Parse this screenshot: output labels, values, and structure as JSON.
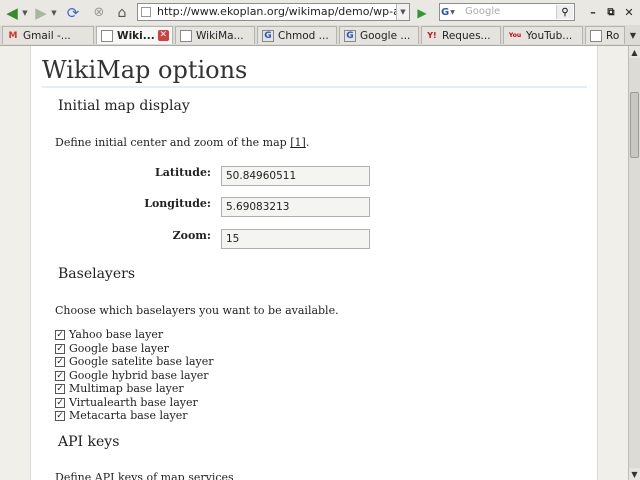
{
  "browser": {
    "url": "http://www.ekoplan.org/wikimap/demo/wp-ac",
    "search_engine": "G",
    "search_placeholder": "Google",
    "tabs": [
      {
        "label": "Gmail -...",
        "icon": "M",
        "icon_color": "#d93025"
      },
      {
        "label": "Wiki...",
        "icon": "",
        "icon_color": "#777777",
        "active": true
      },
      {
        "label": "WikiMa...",
        "icon": "",
        "icon_color": "#777777"
      },
      {
        "label": "Chmod ...",
        "icon": "G",
        "icon_color": "#2355c7"
      },
      {
        "label": "Google ...",
        "icon": "G",
        "icon_color": "#2355c7"
      },
      {
        "label": "Reques...",
        "icon": "Y!",
        "icon_color": "#c4161c"
      },
      {
        "label": "YouTub...",
        "icon": "You",
        "icon_color": "#cc0000"
      },
      {
        "label": "Ro",
        "icon": "",
        "icon_color": "#777777"
      }
    ]
  },
  "page": {
    "title": "WikiMap options",
    "initial": {
      "heading": "Initial map display",
      "description": "Define initial center and zoom of the map ",
      "reference": "[1]",
      "desc_end": ".",
      "latitude_label": "Latitude:",
      "latitude_value": "50.84960511",
      "longitude_label": "Longitude:",
      "longitude_value": "5.69083213",
      "zoom_label": "Zoom:",
      "zoom_value": "15"
    },
    "baselayers": {
      "heading": "Baselayers",
      "description": "Choose which baselayers you want to be available.",
      "items": [
        {
          "label": "Yahoo base layer",
          "checked": true
        },
        {
          "label": "Google base layer",
          "checked": true
        },
        {
          "label": "Google satelite base layer",
          "checked": true
        },
        {
          "label": "Google hybrid base layer",
          "checked": true
        },
        {
          "label": "Multimap base layer",
          "checked": true
        },
        {
          "label": "Virtualearth base layer",
          "checked": true
        },
        {
          "label": "Metacarta base layer",
          "checked": true
        }
      ]
    },
    "api": {
      "heading": "API keys",
      "description": "Define API keys of map services"
    }
  }
}
